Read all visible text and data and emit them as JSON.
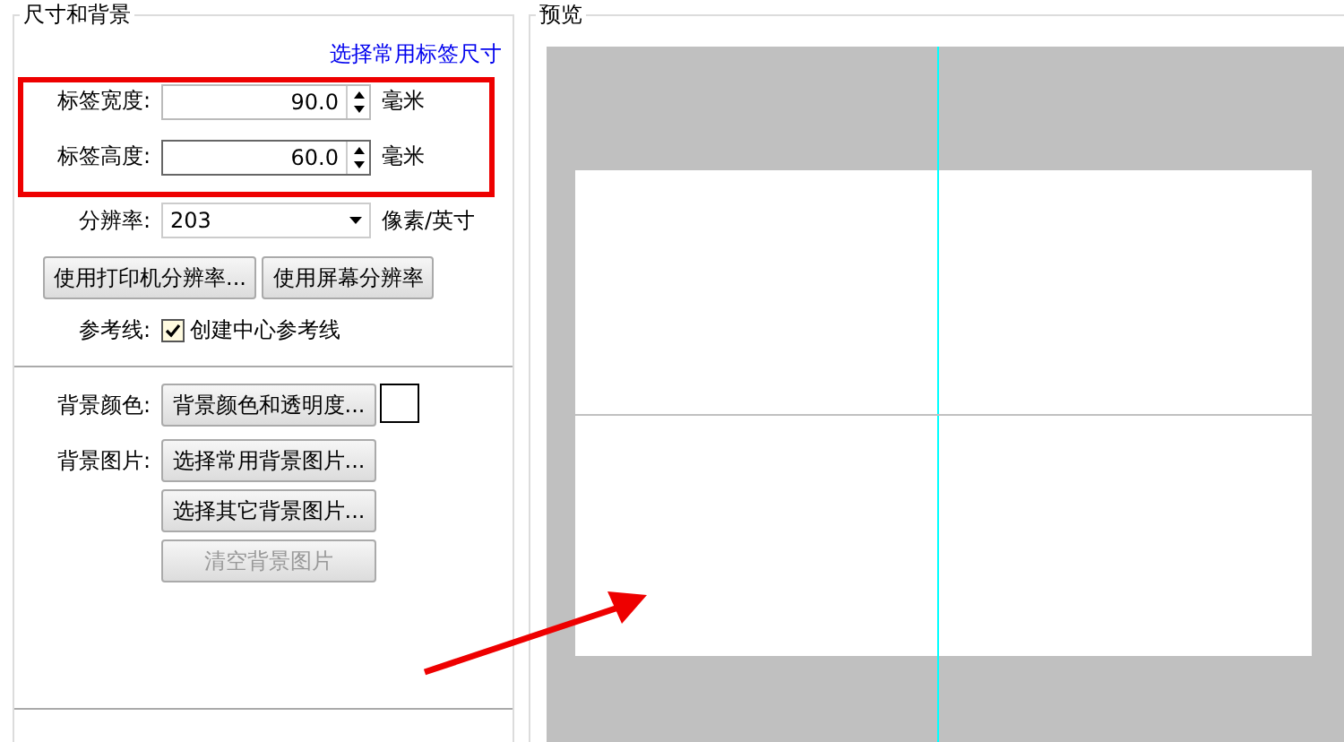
{
  "size_section": {
    "title": "尺寸和背景",
    "preset_link": "选择常用标签尺寸",
    "width": {
      "label": "标签宽度:",
      "value": "90.0",
      "unit": "毫米",
      "focused": false
    },
    "height": {
      "label": "标签高度:",
      "value": "60.0",
      "unit": "毫米",
      "focused": true
    },
    "resolution": {
      "label": "分辨率:",
      "value": "203",
      "unit": "像素/英寸"
    },
    "resolution_buttons": [
      "使用打印机分辨率...",
      "使用屏幕分辨率"
    ],
    "guides": {
      "label": "参考线:",
      "option": "创建中心参考线",
      "checked": true
    }
  },
  "background": {
    "color_label": "背景颜色:",
    "color_button": "背景颜色和透明度...",
    "color": "#ffffff",
    "image_label": "背景图片:",
    "image_buttons": [
      {
        "label": "选择常用背景图片...",
        "disabled": false
      },
      {
        "label": "选择其它背景图片...",
        "disabled": false
      },
      {
        "label": "清空背景图片",
        "disabled": true
      }
    ]
  },
  "preview": {
    "title": "预览"
  }
}
